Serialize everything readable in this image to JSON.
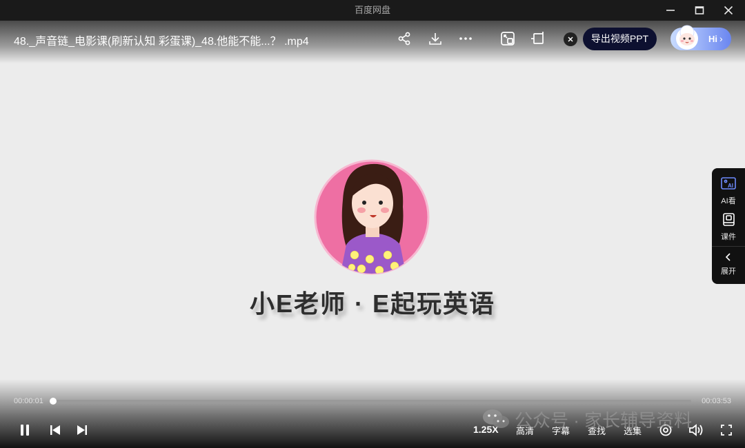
{
  "window": {
    "title": "百度网盘"
  },
  "player": {
    "file_title": "48._声音链_电影课(刷新认知 彩蛋课)_48.他能不能...？ .mp4",
    "export_ppt_label": "导出视频PPT",
    "assistant_label": "Hi",
    "icons": [
      "share-icon",
      "download-icon",
      "more-icon",
      "pip-icon",
      "crop-icon",
      "close-icon"
    ]
  },
  "video_content": {
    "brand_text": "小E老师 · E起玩英语"
  },
  "side_panel": {
    "ai_watch_label": "AI看",
    "courseware_label": "课件",
    "expand_label": "展开"
  },
  "progress": {
    "current_time": "00:00:01",
    "total_time": "00:03:53",
    "played_fraction": 0.004
  },
  "controls": {
    "speed": "1.25X",
    "quality": "高清",
    "subtitle": "字幕",
    "search": "查找",
    "episodes": "选集"
  },
  "watermark": {
    "text": "公众号 · 家长辅导资料"
  },
  "colors": {
    "ppt_button_bg": "#0d1030",
    "assistant_gradient_start": "#c9dcff",
    "assistant_gradient_end": "#6a86f0",
    "avatar_circle": "#ee6fa3",
    "dress": "#9b59c9"
  }
}
